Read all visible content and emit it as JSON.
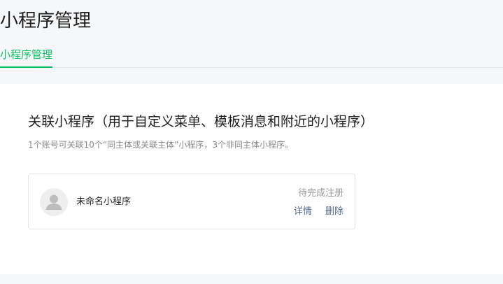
{
  "header": {
    "title": "小程序管理",
    "tabs": [
      {
        "label": "小程序管理",
        "active": true
      }
    ]
  },
  "section": {
    "title": "关联小程序（用于自定义菜单、模板消息和附近的小程序）",
    "description": "1个账号可关联10个“同主体或关联主体”小程序，3个非同主体小程序。"
  },
  "mini_programs": [
    {
      "name": "未命名小程序",
      "avatar_icon": "default-user-icon",
      "status": "待完成注册",
      "actions": {
        "details_label": "详情",
        "delete_label": "删除"
      }
    }
  ],
  "colors": {
    "accent": "#07c160",
    "link": "#576b95",
    "muted": "#9a9a9a",
    "page_bg": "#f6f7f9"
  }
}
